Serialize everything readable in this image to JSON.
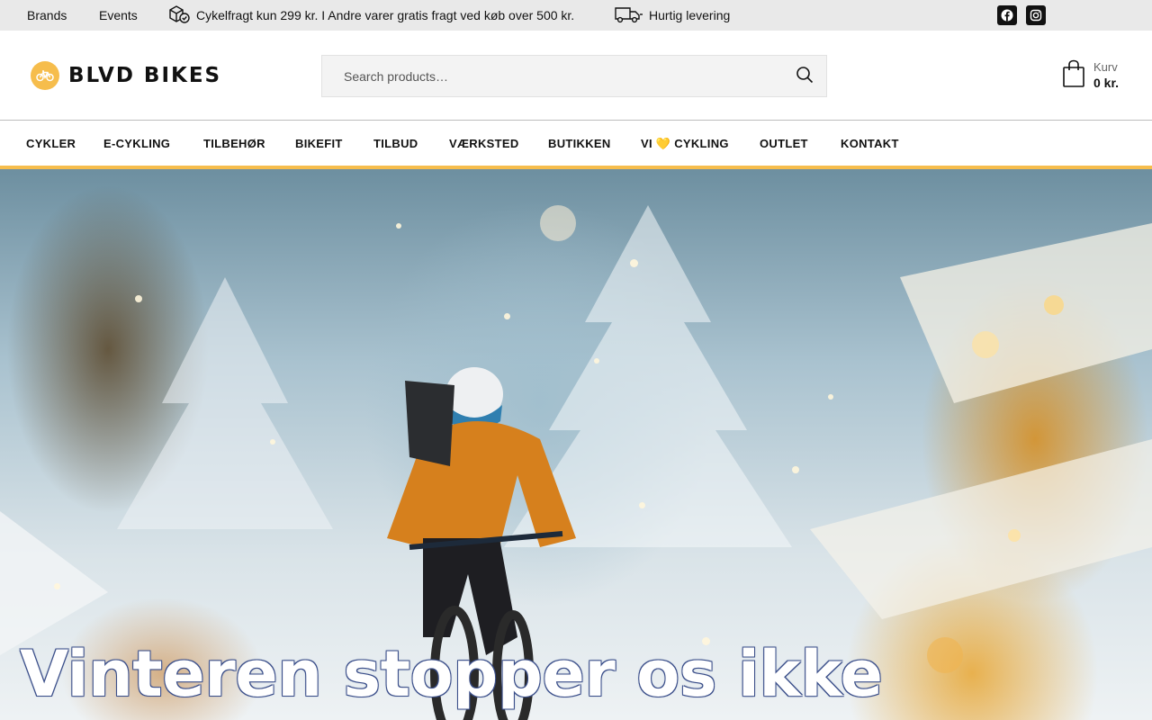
{
  "topbar": {
    "links": [
      "Brands",
      "Events"
    ],
    "shipping_info": "Cykelfragt kun 299 kr. I Andre varer gratis fragt ved køb over 500 kr.",
    "delivery_info": "Hurtig levering",
    "social": [
      "facebook-icon",
      "instagram-icon"
    ]
  },
  "header": {
    "logo_text": "BLVD BIKES",
    "search_placeholder": "Search products…",
    "cart_label": "Kurv",
    "cart_total": "0 kr."
  },
  "nav": {
    "items": [
      "CYKLER",
      "E-CYKLING",
      "TILBEHØR",
      "BIKEFIT",
      "TILBUD",
      "VÆRKSTED",
      "BUTIKKEN",
      "VI 💛 CYKLING",
      "OUTLET",
      "KONTAKT"
    ]
  },
  "hero": {
    "title": "Vinteren stopper os ikke"
  },
  "colors": {
    "accent": "#f6bd4c",
    "topbar_bg": "#e9e9e9",
    "text": "#111111"
  }
}
